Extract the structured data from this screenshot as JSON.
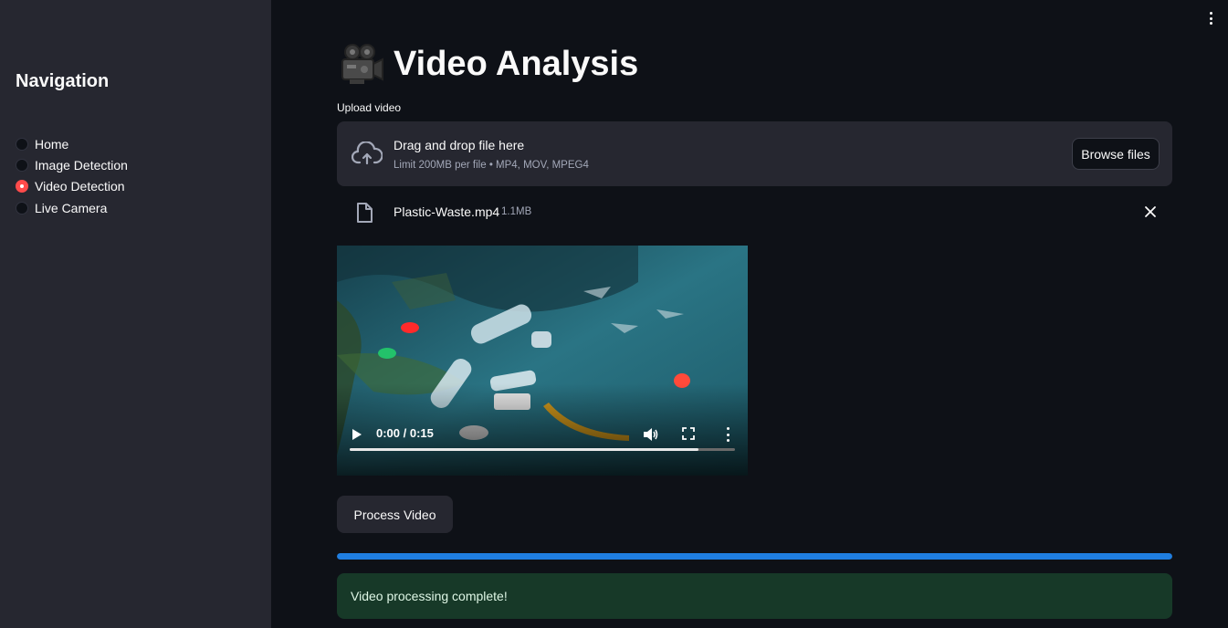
{
  "sidebar": {
    "title": "Navigation",
    "items": [
      {
        "label": "Home",
        "selected": false
      },
      {
        "label": "Image Detection",
        "selected": false
      },
      {
        "label": "Video Detection",
        "selected": true
      },
      {
        "label": "Live Camera",
        "selected": false
      }
    ]
  },
  "header": {
    "title": "Video Analysis",
    "title_icon": "movie-camera-icon",
    "menu_icon": "kebab-menu-icon"
  },
  "uploader": {
    "label": "Upload video",
    "drop_title": "Drag and drop file here",
    "drop_subtitle": "Limit 200MB per file • MP4, MOV, MPEG4",
    "browse_label": "Browse files",
    "icon": "cloud-upload-icon"
  },
  "file": {
    "name": "Plastic-Waste.mp4",
    "size": "1.1MB",
    "icon": "file-icon"
  },
  "video": {
    "time": "0:00 / 0:15",
    "seek_fraction": 0.906
  },
  "actions": {
    "process_label": "Process Video"
  },
  "progress": {
    "fraction": 1.0
  },
  "status": {
    "message": "Video processing complete!"
  },
  "colors": {
    "background": "#0e1117",
    "sidebar": "#262730",
    "accent": "#ff4b4b",
    "progress": "#1f7ee0",
    "success_bg": "#173928"
  }
}
